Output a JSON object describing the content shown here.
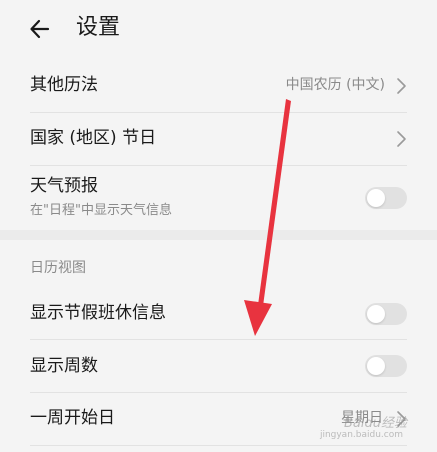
{
  "header": {
    "title": "设置"
  },
  "settings": {
    "other_calendar": {
      "label": "其他历法",
      "value": "中国农历 (中文)"
    },
    "holidays": {
      "label": "国家 (地区) 节日"
    },
    "weather": {
      "label": "天气预报",
      "sub": "在\"日程\"中显示天气信息",
      "enabled": false
    }
  },
  "calendar_view": {
    "section_label": "日历视图",
    "show_holiday_shift": {
      "label": "显示节假班休信息",
      "enabled": false
    },
    "show_week_number": {
      "label": "显示周数",
      "enabled": false
    },
    "week_start": {
      "label": "一周开始日",
      "value": "星期日"
    }
  },
  "watermark": {
    "text": "Baidu经验",
    "sub": "jingyan.baidu.com"
  },
  "colors": {
    "annotation_arrow": "#e8333f",
    "background": "#f4f4f4",
    "toggle_off": "#e1e1e1"
  }
}
